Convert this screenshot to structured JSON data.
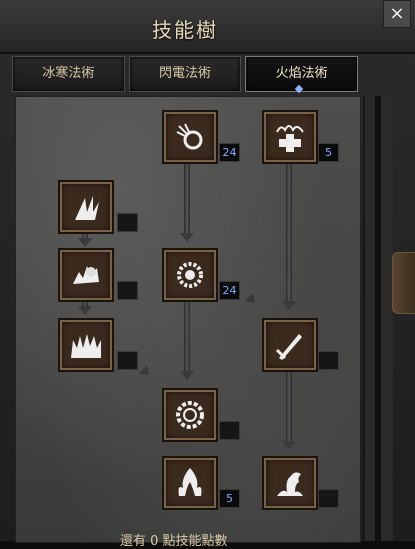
{
  "window": {
    "title": "技能樹",
    "close_label": "×"
  },
  "tabs": [
    {
      "label": "冰寒法術",
      "active": false
    },
    {
      "label": "閃電法術",
      "active": false
    },
    {
      "label": "火焰法術",
      "active": true
    }
  ],
  "skills": [
    {
      "icon": "fire-orb-icon",
      "level": "24"
    },
    {
      "icon": "fire-cross-icon",
      "level": "5"
    },
    {
      "icon": "fire-claw-icon",
      "level": ""
    },
    {
      "icon": "fire-burst-icon",
      "level": ""
    },
    {
      "icon": "fire-ring-icon",
      "level": "24"
    },
    {
      "icon": "fire-wall-icon",
      "level": ""
    },
    {
      "icon": "fire-sword-icon",
      "level": ""
    },
    {
      "icon": "fire-gear-icon",
      "level": ""
    },
    {
      "icon": "fire-flame-icon",
      "level": "5"
    },
    {
      "icon": "fire-hydra-icon",
      "level": ""
    }
  ],
  "footer": {
    "text": "還有 0 點技能點數"
  },
  "colors": {
    "accent": "#7fa8ff",
    "frame": "#2b2b2b",
    "text": "#e8d9b8"
  }
}
